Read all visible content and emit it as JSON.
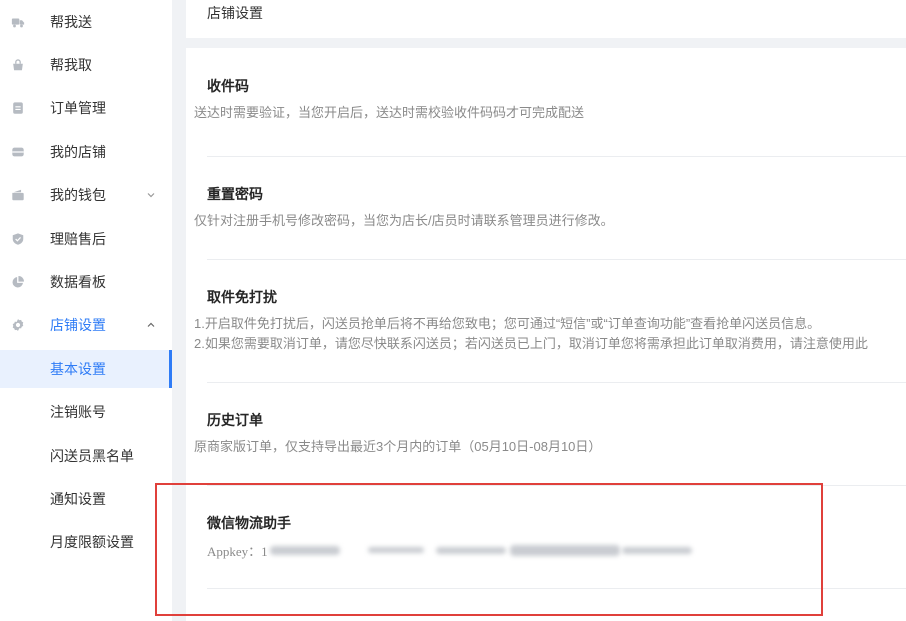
{
  "sidebar": {
    "items": [
      {
        "label": "帮我送",
        "icon": "truck-icon"
      },
      {
        "label": "帮我取",
        "icon": "bag-icon"
      },
      {
        "label": "订单管理",
        "icon": "document-icon"
      },
      {
        "label": "我的店铺",
        "icon": "store-icon"
      },
      {
        "label": "我的钱包",
        "icon": "wallet-icon",
        "expandable": true,
        "expanded": false
      },
      {
        "label": "理赔售后",
        "icon": "shield-icon"
      },
      {
        "label": "数据看板",
        "icon": "pie-chart-icon"
      },
      {
        "label": "店铺设置",
        "icon": "gear-icon",
        "expandable": true,
        "expanded": true
      }
    ],
    "subitems": [
      {
        "label": "基本设置",
        "active": true
      },
      {
        "label": "注销账号"
      },
      {
        "label": "闪送员黑名单"
      },
      {
        "label": "通知设置"
      },
      {
        "label": "月度限额设置"
      }
    ]
  },
  "header": {
    "title": "店铺设置"
  },
  "sections": [
    {
      "title": "收件码",
      "desc": [
        "送达时需要验证，当您开启后，送达时需校验收件码码才可完成配送"
      ]
    },
    {
      "title": "重置密码",
      "desc": [
        "仅针对注册手机号修改密码，当您为店长/店员时请联系管理员进行修改。"
      ]
    },
    {
      "title": "取件免打扰",
      "desc": [
        "1.开启取件免打扰后，闪送员抢单后将不再给您致电；您可通过“短信”或“订单查询功能”查看抢单闪送员信息。",
        "2.如果您需要取消订单，请您尽快联系闪送员；若闪送员已上门，取消订单您将需承担此订单取消费用，请注意使用此"
      ]
    },
    {
      "title": "历史订单",
      "desc": [
        "原商家版订单，仅支持导出最近3个月内的订单（05月10日-08月10日）"
      ]
    },
    {
      "title": "微信物流助手",
      "appkey_label": "Appkey：1",
      "appkey_redacted": true
    }
  ],
  "colors": {
    "accent": "#2f7cf6",
    "active_background": "#e9f1fe",
    "annotation": "#e0403b"
  }
}
